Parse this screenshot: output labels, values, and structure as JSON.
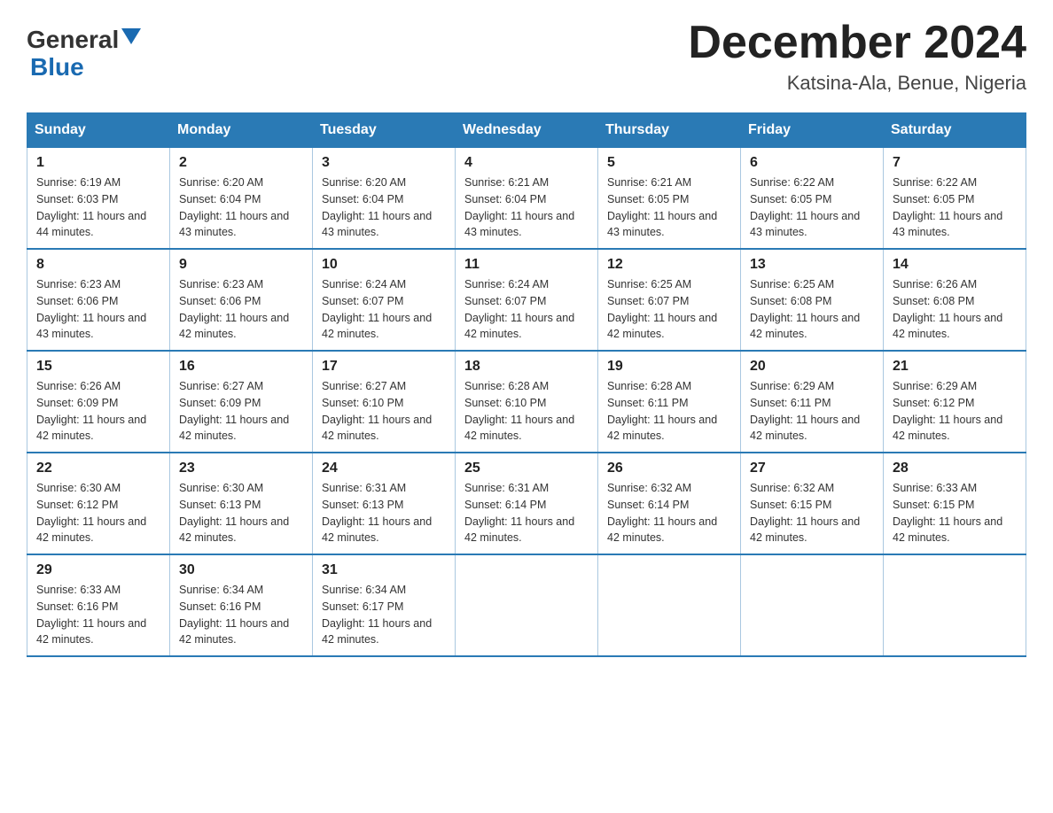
{
  "header": {
    "logo_general": "General",
    "logo_blue": "Blue",
    "month_title": "December 2024",
    "location": "Katsina-Ala, Benue, Nigeria"
  },
  "weekdays": [
    "Sunday",
    "Monday",
    "Tuesday",
    "Wednesday",
    "Thursday",
    "Friday",
    "Saturday"
  ],
  "weeks": [
    [
      {
        "day": "1",
        "sunrise": "6:19 AM",
        "sunset": "6:03 PM",
        "daylight": "11 hours and 44 minutes."
      },
      {
        "day": "2",
        "sunrise": "6:20 AM",
        "sunset": "6:04 PM",
        "daylight": "11 hours and 43 minutes."
      },
      {
        "day": "3",
        "sunrise": "6:20 AM",
        "sunset": "6:04 PM",
        "daylight": "11 hours and 43 minutes."
      },
      {
        "day": "4",
        "sunrise": "6:21 AM",
        "sunset": "6:04 PM",
        "daylight": "11 hours and 43 minutes."
      },
      {
        "day": "5",
        "sunrise": "6:21 AM",
        "sunset": "6:05 PM",
        "daylight": "11 hours and 43 minutes."
      },
      {
        "day": "6",
        "sunrise": "6:22 AM",
        "sunset": "6:05 PM",
        "daylight": "11 hours and 43 minutes."
      },
      {
        "day": "7",
        "sunrise": "6:22 AM",
        "sunset": "6:05 PM",
        "daylight": "11 hours and 43 minutes."
      }
    ],
    [
      {
        "day": "8",
        "sunrise": "6:23 AM",
        "sunset": "6:06 PM",
        "daylight": "11 hours and 43 minutes."
      },
      {
        "day": "9",
        "sunrise": "6:23 AM",
        "sunset": "6:06 PM",
        "daylight": "11 hours and 42 minutes."
      },
      {
        "day": "10",
        "sunrise": "6:24 AM",
        "sunset": "6:07 PM",
        "daylight": "11 hours and 42 minutes."
      },
      {
        "day": "11",
        "sunrise": "6:24 AM",
        "sunset": "6:07 PM",
        "daylight": "11 hours and 42 minutes."
      },
      {
        "day": "12",
        "sunrise": "6:25 AM",
        "sunset": "6:07 PM",
        "daylight": "11 hours and 42 minutes."
      },
      {
        "day": "13",
        "sunrise": "6:25 AM",
        "sunset": "6:08 PM",
        "daylight": "11 hours and 42 minutes."
      },
      {
        "day": "14",
        "sunrise": "6:26 AM",
        "sunset": "6:08 PM",
        "daylight": "11 hours and 42 minutes."
      }
    ],
    [
      {
        "day": "15",
        "sunrise": "6:26 AM",
        "sunset": "6:09 PM",
        "daylight": "11 hours and 42 minutes."
      },
      {
        "day": "16",
        "sunrise": "6:27 AM",
        "sunset": "6:09 PM",
        "daylight": "11 hours and 42 minutes."
      },
      {
        "day": "17",
        "sunrise": "6:27 AM",
        "sunset": "6:10 PM",
        "daylight": "11 hours and 42 minutes."
      },
      {
        "day": "18",
        "sunrise": "6:28 AM",
        "sunset": "6:10 PM",
        "daylight": "11 hours and 42 minutes."
      },
      {
        "day": "19",
        "sunrise": "6:28 AM",
        "sunset": "6:11 PM",
        "daylight": "11 hours and 42 minutes."
      },
      {
        "day": "20",
        "sunrise": "6:29 AM",
        "sunset": "6:11 PM",
        "daylight": "11 hours and 42 minutes."
      },
      {
        "day": "21",
        "sunrise": "6:29 AM",
        "sunset": "6:12 PM",
        "daylight": "11 hours and 42 minutes."
      }
    ],
    [
      {
        "day": "22",
        "sunrise": "6:30 AM",
        "sunset": "6:12 PM",
        "daylight": "11 hours and 42 minutes."
      },
      {
        "day": "23",
        "sunrise": "6:30 AM",
        "sunset": "6:13 PM",
        "daylight": "11 hours and 42 minutes."
      },
      {
        "day": "24",
        "sunrise": "6:31 AM",
        "sunset": "6:13 PM",
        "daylight": "11 hours and 42 minutes."
      },
      {
        "day": "25",
        "sunrise": "6:31 AM",
        "sunset": "6:14 PM",
        "daylight": "11 hours and 42 minutes."
      },
      {
        "day": "26",
        "sunrise": "6:32 AM",
        "sunset": "6:14 PM",
        "daylight": "11 hours and 42 minutes."
      },
      {
        "day": "27",
        "sunrise": "6:32 AM",
        "sunset": "6:15 PM",
        "daylight": "11 hours and 42 minutes."
      },
      {
        "day": "28",
        "sunrise": "6:33 AM",
        "sunset": "6:15 PM",
        "daylight": "11 hours and 42 minutes."
      }
    ],
    [
      {
        "day": "29",
        "sunrise": "6:33 AM",
        "sunset": "6:16 PM",
        "daylight": "11 hours and 42 minutes."
      },
      {
        "day": "30",
        "sunrise": "6:34 AM",
        "sunset": "6:16 PM",
        "daylight": "11 hours and 42 minutes."
      },
      {
        "day": "31",
        "sunrise": "6:34 AM",
        "sunset": "6:17 PM",
        "daylight": "11 hours and 42 minutes."
      },
      null,
      null,
      null,
      null
    ]
  ],
  "labels": {
    "sunrise_prefix": "Sunrise: ",
    "sunset_prefix": "Sunset: ",
    "daylight_prefix": "Daylight: "
  }
}
